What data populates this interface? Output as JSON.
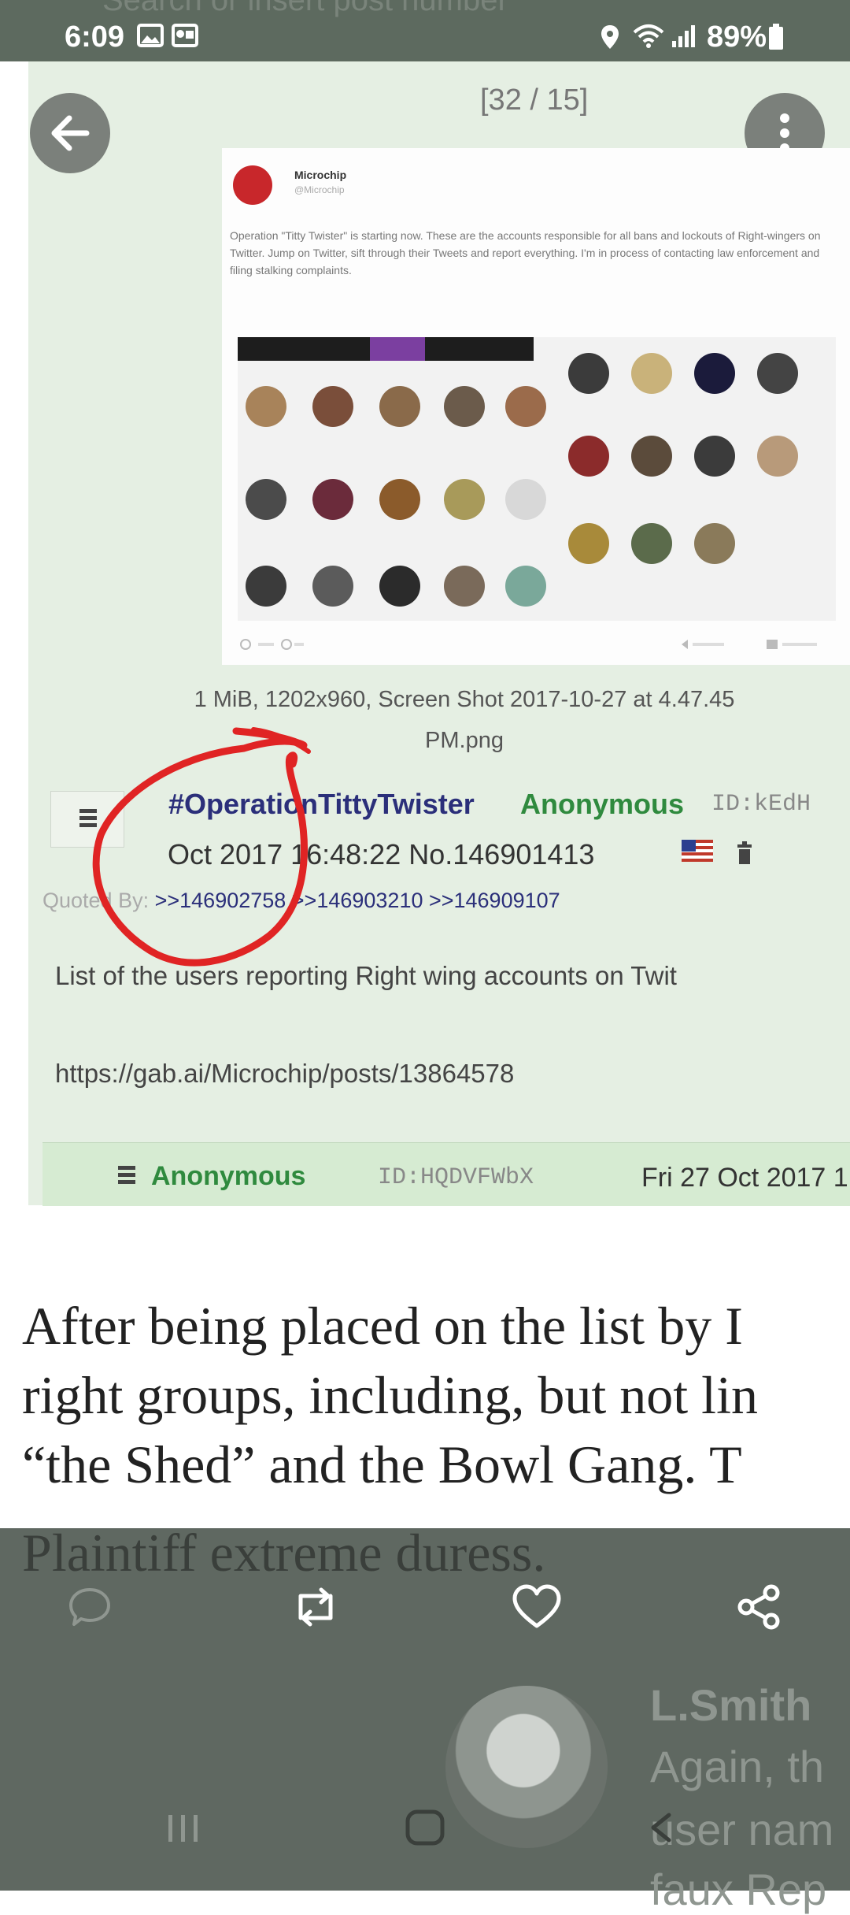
{
  "status_bar": {
    "time": "6:09",
    "battery": "89%",
    "background_text": "Search or insert post number"
  },
  "viewer": {
    "counter": "[32 / 15]"
  },
  "tweet": {
    "author": "Microchip",
    "handle": "@Microchip",
    "text": "Operation \"Titty Twister\" is starting now. These are the accounts responsible for all bans and lockouts of Right-wingers on Twitter. Jump on Twitter, sift through their Tweets and report everything. I'm in process of contacting law enforcement and filing stalking complaints."
  },
  "file_info": {
    "line1": "1 MiB, 1202x960, Screen Shot 2017-10-27 at 4.47.45",
    "line2": "PM.png"
  },
  "post": {
    "subject": "#OperationTittyTwister",
    "name": "Anonymous",
    "id": "ID:kEdH",
    "date": "Oct 2017 16:48:22 No.146901413",
    "quoted_label": "Quoted By:",
    "quoted_links": ">>146902758 >>146903210 >>146909107",
    "body_line1": "List of the users reporting Right wing accounts on Twit",
    "body_line2": "https://gab.ai/Microchip/posts/13864578"
  },
  "reply": {
    "name": "Anonymous",
    "id": "ID:HQDVFWbX",
    "date": "Fri 27 Oct 2017 1"
  },
  "document": {
    "line1": "After being placed on the list by I",
    "line2": "right groups, including, but not lin",
    "line3": "“the Shed” and the Bowl Gang. T",
    "line4": "Plaintiff extreme duress."
  },
  "comment": {
    "author": "L.Smith",
    "line1": "Again, th",
    "line2": "user nam",
    "line3": "faux Rep"
  },
  "colors": {
    "status_bar": "#5d6a5f",
    "post_background": "#e5efe3",
    "subject": "#2b2f7a",
    "name": "#2f8a3e",
    "circle_annotation": "#e02424",
    "overlay": "#5f6861"
  }
}
